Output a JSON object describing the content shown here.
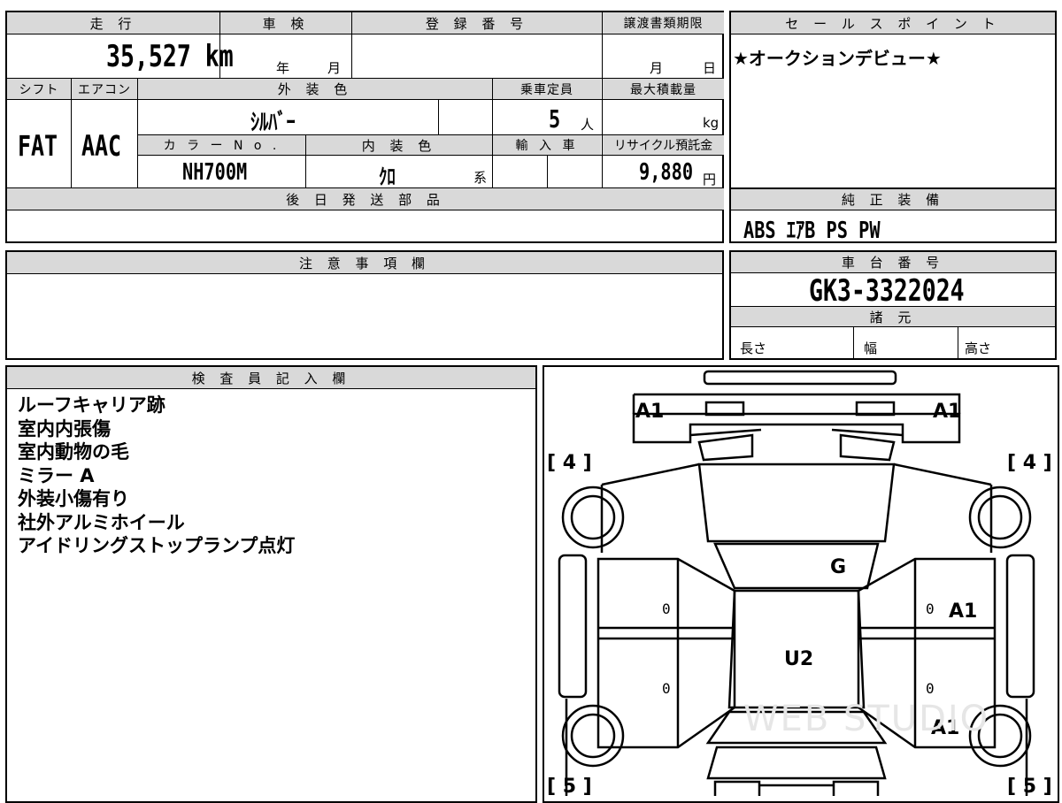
{
  "header": {
    "mileage_label": "走 行",
    "inspection_label": "車 検",
    "registration_label": "登 録 番 号",
    "transfer_deadline_label": "譲渡書類期限",
    "mileage_value": "35,527 km",
    "year_unit": "年",
    "month_unit": "月",
    "deadline_month_unit": "月",
    "deadline_day_unit": "日"
  },
  "specs": {
    "shift_label": "シフト",
    "aircon_label": "エアコン",
    "exterior_color_label": "外 装 色",
    "capacity_label": "乗車定員",
    "max_load_label": "最大積載量",
    "shift_value": "FAT",
    "aircon_value": "AAC",
    "exterior_color_value": "ｼﾙﾊﾞｰ",
    "capacity_value": "5",
    "capacity_unit": "人",
    "max_load_unit": "kg",
    "color_no_label": "カ ラ ー N o .",
    "interior_color_label": "内 装 色",
    "import_label": "輸 入 車",
    "recycle_label": "リサイクル預託金",
    "color_no_value": "NH700M",
    "interior_color_value": "ｸﾛ",
    "interior_color_suffix": "系",
    "recycle_value": "9,880",
    "recycle_unit": "円"
  },
  "sales_point": {
    "label": "セ ー ル ス ポ イ ン ト",
    "text": "★オークションデビュー★"
  },
  "later_parts": {
    "label": "後 日 発 送 部 品"
  },
  "genuine_equipment": {
    "label": "純 正 装 備",
    "value": "ABS ｴｱB PS PW"
  },
  "caution": {
    "label": "注 意 事 項 欄"
  },
  "chassis": {
    "label": "車 台 番 号",
    "value": "GK3-3322024",
    "specs_label": "諸 元",
    "length_label": "長さ",
    "width_label": "幅",
    "height_label": "高さ"
  },
  "inspector": {
    "label": "検 査 員 記 入 欄",
    "notes": [
      "ルーフキャリア跡",
      "室内内張傷",
      "室内動物の毛",
      "ミラー A",
      "外装小傷有り",
      "社外アルミホイール",
      "アイドリングストップランプ点灯"
    ]
  },
  "diagram": {
    "mark_front_left": "A1",
    "mark_front_right": "A1",
    "tire_front_left": "[ 4 ]",
    "tire_front_right": "[ 4 ]",
    "tire_rear_left": "[ 5 ]",
    "tire_rear_right": "[ 5 ]",
    "mark_glass": "G",
    "mark_roof": "U2",
    "mark_door_right_front": "A1",
    "mark_quarter_right": "A1",
    "zero_left_front": "0",
    "zero_left_rear": "0",
    "zero_right_front": "0",
    "zero_right_rear": "0",
    "watermark": "WEB STUDIO"
  }
}
